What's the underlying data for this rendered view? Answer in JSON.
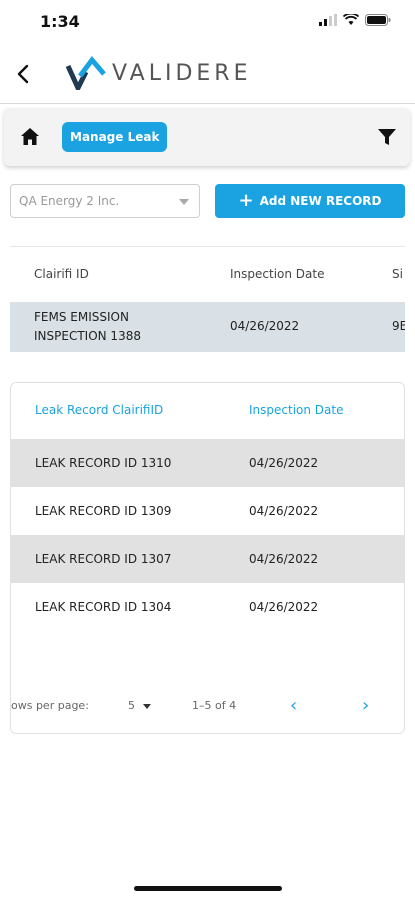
{
  "status_bar": {
    "time": "1:34"
  },
  "header": {
    "brand": "VALIDERE"
  },
  "toolbar": {
    "chip_label": "Manage Leak"
  },
  "controls": {
    "company_value": "QA Energy 2 Inc.",
    "add_button_label": "Add NEW RECORD"
  },
  "inspection_table": {
    "columns": [
      "Clairifi ID",
      "Inspection Date",
      "Si"
    ],
    "row": {
      "id_line1": "FEMS EMISSION",
      "id_line2": "INSPECTION 1388",
      "date": "04/26/2022",
      "site": "9E"
    }
  },
  "leak_table": {
    "columns": [
      "Leak Record ClairifiID",
      "Inspection Date"
    ],
    "rows": [
      {
        "id": "LEAK RECORD ID 1310",
        "date": "04/26/2022"
      },
      {
        "id": "LEAK RECORD ID 1309",
        "date": "04/26/2022"
      },
      {
        "id": "LEAK RECORD ID 1307",
        "date": "04/26/2022"
      },
      {
        "id": "LEAK RECORD ID 1304",
        "date": "04/26/2022"
      }
    ],
    "pagination": {
      "rows_per_page_label": "ows per page:",
      "rows_per_page": "5",
      "range": "1–5 of 4",
      "prev": "‹",
      "next": "›"
    }
  },
  "colors": {
    "accent": "#1aa3e0",
    "row_shade": "#e1e1e1",
    "inspection_row": "#d9e1e6"
  },
  "icons": [
    "back-arrow-icon",
    "validere-logo",
    "home-icon",
    "filter-icon",
    "plus-icon",
    "dropdown-caret-icon",
    "chevron-left-icon",
    "chevron-right-icon"
  ]
}
